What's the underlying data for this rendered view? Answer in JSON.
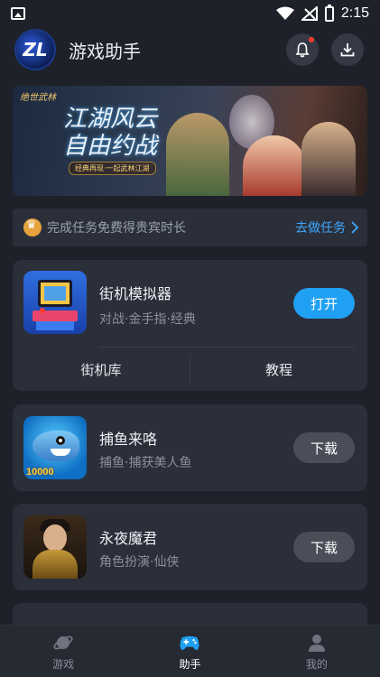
{
  "status_bar": {
    "time": "2:15"
  },
  "header": {
    "logo_text": "ZL",
    "title": "游戏助手",
    "icons": [
      "bell-icon",
      "download-icon"
    ]
  },
  "banner": {
    "subtitle": "绝世武林",
    "headline": "江湖风云 自由约战",
    "tag": "经典再现·一起武林江湖"
  },
  "task": {
    "text": "完成任务免费得贵宾时长",
    "link": "去做任务"
  },
  "apps": [
    {
      "name": "街机模拟器",
      "desc": "对战·金手指·经典",
      "action": "打开",
      "icon": "arcade-machine"
    },
    {
      "name": "捕鱼来咯",
      "desc": "捕鱼·捕获美人鱼",
      "action": "下载",
      "icon": "fish-game",
      "thumb_text": "10000"
    },
    {
      "name": "永夜魔君",
      "desc": "角色扮演·仙侠",
      "action": "下载",
      "icon": "demon-lord"
    }
  ],
  "arcade_tabs": [
    "街机库",
    "教程"
  ],
  "bottom_nav": [
    {
      "label": "游戏",
      "icon": "planet-icon",
      "active": false
    },
    {
      "label": "助手",
      "icon": "gamepad-icon",
      "active": true
    },
    {
      "label": "我的",
      "icon": "person-icon",
      "active": false
    }
  ],
  "colors": {
    "background": "#1e2129",
    "card": "#2b2f3a",
    "accent": "#1fa0f2",
    "link": "#3ea8ff",
    "notification_dot": "#ff3b30"
  }
}
